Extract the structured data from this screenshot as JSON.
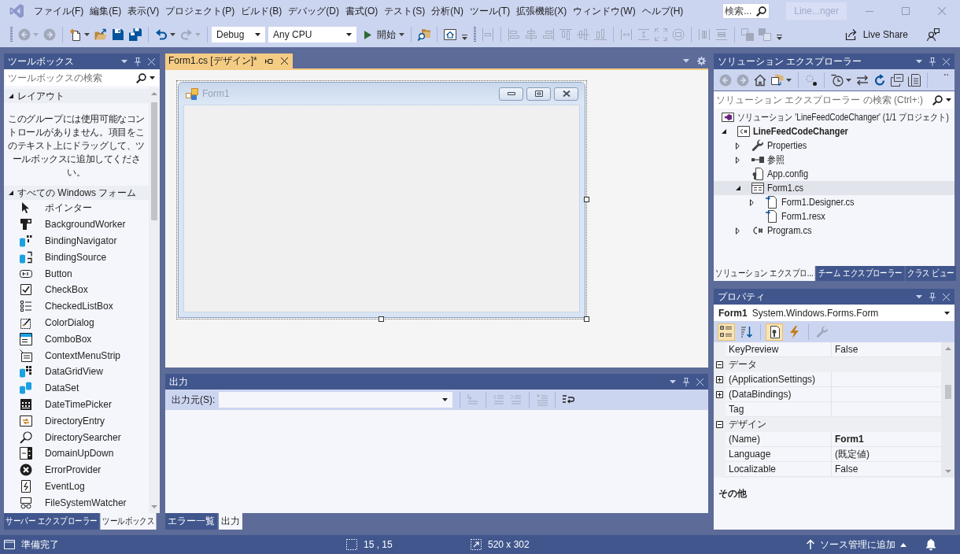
{
  "window": {
    "title": "Line...nger",
    "search": {
      "placeholder": "検索..."
    }
  },
  "menu": [
    "ファイル(F)",
    "編集(E)",
    "表示(V)",
    "プロジェクト(P)",
    "ビルド(B)",
    "デバッグ(D)",
    "書式(O)",
    "テスト(S)",
    "分析(N)",
    "ツール(T)",
    "拡張機能(X)",
    "ウィンドウ(W)",
    "ヘルプ(H)"
  ],
  "toolbar": {
    "items": [
      {
        "kind": "grip"
      },
      {
        "kind": "button",
        "disabled": true
      },
      {
        "kind": "caret",
        "disabled": true
      },
      {
        "kind": "button",
        "disabled": true
      },
      {
        "kind": "separator"
      },
      {
        "kind": "button",
        "disabled": false
      },
      {
        "kind": "caret",
        "disabled": false
      },
      {
        "kind": "button",
        "disabled": false
      },
      {
        "kind": "button",
        "disabled": false
      },
      {
        "kind": "button",
        "disabled": false
      },
      {
        "kind": "separator"
      },
      {
        "kind": "button",
        "disabled": false
      },
      {
        "kind": "caret",
        "disabled": false
      },
      {
        "kind": "button",
        "disabled": true
      },
      {
        "kind": "caret",
        "disabled": true
      },
      {
        "kind": "separator"
      },
      {
        "kind": "combo",
        "value": "Debug"
      },
      {
        "kind": "combo",
        "value": "Any CPU"
      },
      {
        "kind": "start",
        "label": "開始"
      },
      {
        "kind": "caret",
        "disabled": false
      },
      {
        "kind": "separator"
      },
      {
        "kind": "button",
        "disabled": false
      },
      {
        "kind": "separator"
      },
      {
        "kind": "button",
        "disabled": false
      },
      {
        "kind": "overflow"
      },
      {
        "kind": "grip"
      },
      {
        "kind": "button",
        "disabled": true
      },
      {
        "kind": "separator"
      },
      {
        "kind": "button",
        "disabled": true
      },
      {
        "kind": "button",
        "disabled": true
      },
      {
        "kind": "button",
        "disabled": true
      },
      {
        "kind": "button",
        "disabled": true
      },
      {
        "kind": "button",
        "disabled": true
      },
      {
        "kind": "button",
        "disabled": true
      },
      {
        "kind": "separator"
      },
      {
        "kind": "button",
        "disabled": true
      },
      {
        "kind": "button",
        "disabled": true
      },
      {
        "kind": "button",
        "disabled": true
      },
      {
        "kind": "button",
        "disabled": true
      },
      {
        "kind": "separator"
      },
      {
        "kind": "button",
        "disabled": true
      },
      {
        "kind": "button",
        "disabled": true
      },
      {
        "kind": "separator"
      },
      {
        "kind": "button",
        "disabled": true
      },
      {
        "kind": "button",
        "disabled": true
      },
      {
        "kind": "overflow"
      }
    ],
    "live_share": "Live Share"
  },
  "toolbox": {
    "title": "ツールボックス",
    "search": {
      "placeholder": "ツールボックスの検索"
    },
    "groups": [
      {
        "label": "レイアウト",
        "expanded": true,
        "message": "このグループには使用可能なコントロールがありません。項目をこのテキスト上にドラッグして、ツールボックスに追加してください。"
      },
      {
        "label": "すべての Windows フォーム",
        "expanded": true,
        "items": [
          "ポインター",
          "BackgroundWorker",
          "BindingNavigator",
          "BindingSource",
          "Button",
          "CheckBox",
          "CheckedListBox",
          "ColorDialog",
          "ComboBox",
          "ContextMenuStrip",
          "DataGridView",
          "DataSet",
          "DateTimePicker",
          "DirectoryEntry",
          "DirectorySearcher",
          "DomainUpDown",
          "ErrorProvider",
          "EventLog",
          "FileSystemWatcher"
        ]
      }
    ],
    "tabs": [
      {
        "label": "サーバー エクスプローラー",
        "selected": false
      },
      {
        "label": "ツールボックス",
        "selected": true
      }
    ]
  },
  "editor": {
    "tabs": [
      {
        "label": "Form1.cs [デザイン]*",
        "selected": true
      }
    ],
    "form": {
      "title": "Form1"
    }
  },
  "output": {
    "title": "出力",
    "source_label": "出力元(S):",
    "toolbar": [
      {
        "kind": "separator"
      },
      {
        "kind": "button",
        "disabled": true
      },
      {
        "kind": "separator"
      },
      {
        "kind": "button",
        "disabled": true
      },
      {
        "kind": "button",
        "disabled": true
      },
      {
        "kind": "separator"
      },
      {
        "kind": "button",
        "disabled": true
      },
      {
        "kind": "separator"
      },
      {
        "kind": "button",
        "disabled": false
      }
    ],
    "tabs": [
      {
        "label": "エラー一覧",
        "selected": false
      },
      {
        "label": "出力",
        "selected": true
      }
    ]
  },
  "solution_explorer": {
    "title": "ソリューション エクスプローラー",
    "toolbar": [
      {
        "kind": "button",
        "disabled": true
      },
      {
        "kind": "button",
        "disabled": true
      },
      {
        "kind": "button",
        "disabled": false
      },
      {
        "kind": "button",
        "disabled": false
      },
      {
        "kind": "caret",
        "disabled": false
      },
      {
        "kind": "separator"
      },
      {
        "kind": "button",
        "disabled": false
      },
      {
        "kind": "separator"
      },
      {
        "kind": "button",
        "disabled": false
      },
      {
        "kind": "caret",
        "disabled": false
      },
      {
        "kind": "button",
        "disabled": false
      },
      {
        "kind": "button",
        "disabled": false
      },
      {
        "kind": "button",
        "disabled": false
      },
      {
        "kind": "button",
        "disabled": false
      },
      {
        "kind": "separator"
      },
      {
        "kind": "overflow"
      }
    ],
    "search": {
      "placeholder": "ソリューション エクスプローラー の検索 (Ctrl+:)"
    },
    "tree": [
      {
        "label": "ソリューション 'LineFeedCodeChanger' (1/1 プロジェクト)",
        "selected": false,
        "children": [
          {
            "label": "LineFeedCodeChanger",
            "selected": false,
            "expanded": true,
            "startup": true,
            "children": [
              {
                "label": "Properties",
                "selected": false,
                "expanded": false
              },
              {
                "label": "参照",
                "selected": false,
                "expanded": false
              },
              {
                "label": "App.config",
                "selected": false
              },
              {
                "label": "Form1.cs",
                "selected": true,
                "expanded": true,
                "children": [
                  {
                    "label": "Form1.Designer.cs",
                    "selected": false,
                    "expanded": false
                  },
                  {
                    "label": "Form1.resx",
                    "selected": false
                  }
                ]
              },
              {
                "label": "Program.cs",
                "selected": false,
                "expanded": false
              }
            ]
          }
        ]
      }
    ],
    "tabs": [
      {
        "label": "ソリューション エクスプロ...",
        "selected": true
      },
      {
        "label": "チーム エクスプローラー",
        "selected": false
      },
      {
        "label": "クラス ビュー",
        "selected": false
      }
    ]
  },
  "properties": {
    "title": "プロパティ",
    "object": {
      "name": "Form1",
      "type": "System.Windows.Forms.Form"
    },
    "toolbar": [
      {
        "kind": "button",
        "selected": true,
        "disabled": false
      },
      {
        "kind": "button",
        "selected": false,
        "disabled": false
      },
      {
        "kind": "separator"
      },
      {
        "kind": "button",
        "selected": true,
        "disabled": false
      },
      {
        "kind": "button",
        "selected": false,
        "disabled": false
      },
      {
        "kind": "separator"
      },
      {
        "kind": "button",
        "selected": false,
        "disabled": true
      }
    ],
    "rows": [
      {
        "kind": "property",
        "name": "KeyPreview",
        "value": "False",
        "modified": false
      },
      {
        "kind": "category",
        "name": "データ",
        "expanded": true
      },
      {
        "kind": "property",
        "name": "(ApplicationSettings)",
        "expanded": false
      },
      {
        "kind": "property",
        "name": "(DataBindings)",
        "expanded": false
      },
      {
        "kind": "property",
        "name": "Tag"
      },
      {
        "kind": "category",
        "name": "デザイン",
        "expanded": true
      },
      {
        "kind": "property",
        "name": "(Name)",
        "value": "Form1",
        "modified": true
      },
      {
        "kind": "property",
        "name": "Language",
        "value": "(既定値)",
        "modified": false
      },
      {
        "kind": "property",
        "name": "Localizable",
        "value": "False",
        "modified": false
      }
    ],
    "description": "その他"
  },
  "status_bar": {
    "message": "準備完了",
    "position": "15 , 15",
    "size": "520 x 302",
    "source_control": "ソース管理に追加"
  }
}
